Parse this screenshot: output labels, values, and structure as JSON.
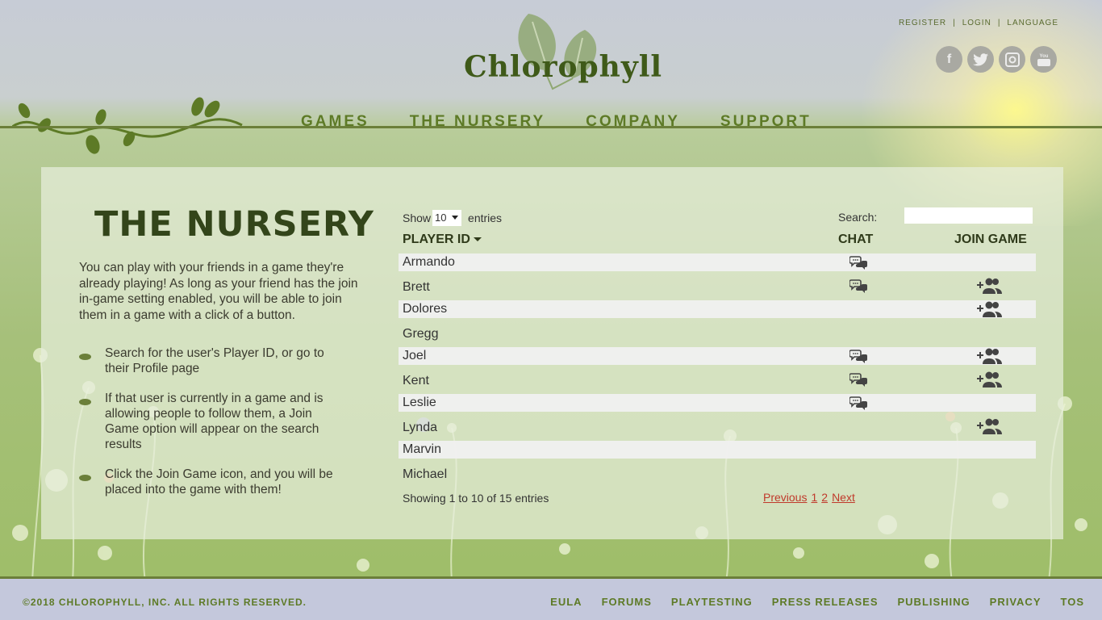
{
  "brand": {
    "name": "Chlorophyll"
  },
  "top_links": {
    "register": "REGISTER",
    "login": "LOGIN",
    "language": "LANGUAGE",
    "separator": "|"
  },
  "social": {
    "facebook": "f",
    "twitter": "t",
    "instagram": "◘",
    "youtube": "You Tube"
  },
  "nav": {
    "games": "GAMES",
    "nursery": "THE NURSERY",
    "company": "COMPANY",
    "support": "SUPPORT"
  },
  "page": {
    "title": "THE NURSERY",
    "intro": "You can play with your friends in a game they're already playing! As long as your friend has the join in-game setting enabled, you will be able to join them in a game with a click of a button.",
    "steps": [
      "Search for the user's Player ID, or go to their Profile page",
      "If that user is currently in a game and is allowing people to follow them, a Join Game option will appear on the search results",
      "Click the Join Game icon, and you will be placed into the game with them!"
    ]
  },
  "table": {
    "show_label": "Show",
    "entries_value": "10",
    "entries_label": "entries",
    "search_label": "Search:",
    "columns": {
      "player_id": "PLAYER ID",
      "chat": "CHAT",
      "join": "JOIN GAME"
    },
    "rows": [
      {
        "name": "Armando",
        "chat": true,
        "join": false
      },
      {
        "name": "Brett",
        "chat": true,
        "join": true
      },
      {
        "name": "Dolores",
        "chat": false,
        "join": true
      },
      {
        "name": "Gregg",
        "chat": false,
        "join": false
      },
      {
        "name": "Joel",
        "chat": true,
        "join": true
      },
      {
        "name": "Kent",
        "chat": true,
        "join": true
      },
      {
        "name": "Leslie",
        "chat": true,
        "join": false
      },
      {
        "name": "Lynda",
        "chat": false,
        "join": true
      },
      {
        "name": "Marvin",
        "chat": false,
        "join": false
      },
      {
        "name": "Michael",
        "chat": false,
        "join": false
      }
    ],
    "info": "Showing 1 to 10 of 15 entries",
    "pager": {
      "previous": "Previous",
      "page1": "1",
      "page2": "2",
      "next": "Next"
    }
  },
  "footer": {
    "copyright": "©2018 CHLOROPHYLL, INC.  ALL RIGHTS RESERVED.",
    "links": {
      "eula": "EULA",
      "forums": "FORUMS",
      "playtesting": "PLAYTESTING",
      "press": "PRESS RELEASES",
      "publishing": "PUBLISHING",
      "privacy": "PRIVACY",
      "tos": "TOS"
    }
  },
  "colors": {
    "brand_green": "#3f5a19",
    "nav_green": "#5d7a26",
    "link_red": "#c0392b"
  }
}
